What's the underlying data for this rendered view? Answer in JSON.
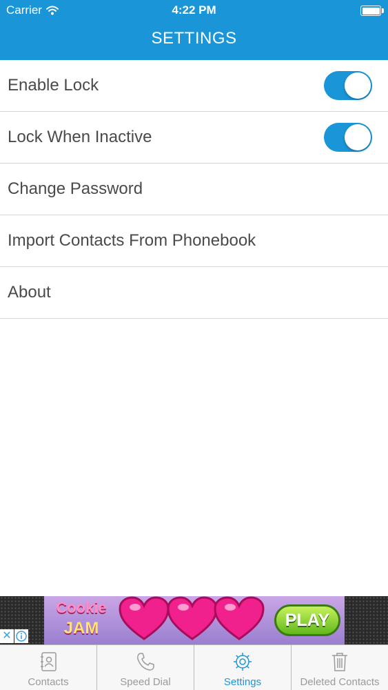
{
  "status_bar": {
    "carrier": "Carrier",
    "time": "4:22 PM"
  },
  "header": {
    "title": "SETTINGS",
    "color": "#1a96d8"
  },
  "settings": {
    "items": [
      {
        "label": "Enable Lock",
        "toggle": true,
        "on": true
      },
      {
        "label": "Lock When Inactive",
        "toggle": true,
        "on": true
      },
      {
        "label": "Change Password",
        "toggle": false
      },
      {
        "label": "Import Contacts From Phonebook",
        "toggle": false
      },
      {
        "label": "About",
        "toggle": false
      }
    ]
  },
  "ad": {
    "logo_top": "Cookie",
    "logo_bottom": "JAM",
    "cta": "PLAY",
    "close": "✕"
  },
  "tabs": {
    "items": [
      {
        "label": "Contacts",
        "icon": "address-book-icon",
        "active": false
      },
      {
        "label": "Speed Dial",
        "icon": "phone-icon",
        "active": false
      },
      {
        "label": "Settings",
        "icon": "gear-icon",
        "active": true
      },
      {
        "label": "Deleted Contacts",
        "icon": "trash-icon",
        "active": false
      }
    ]
  }
}
